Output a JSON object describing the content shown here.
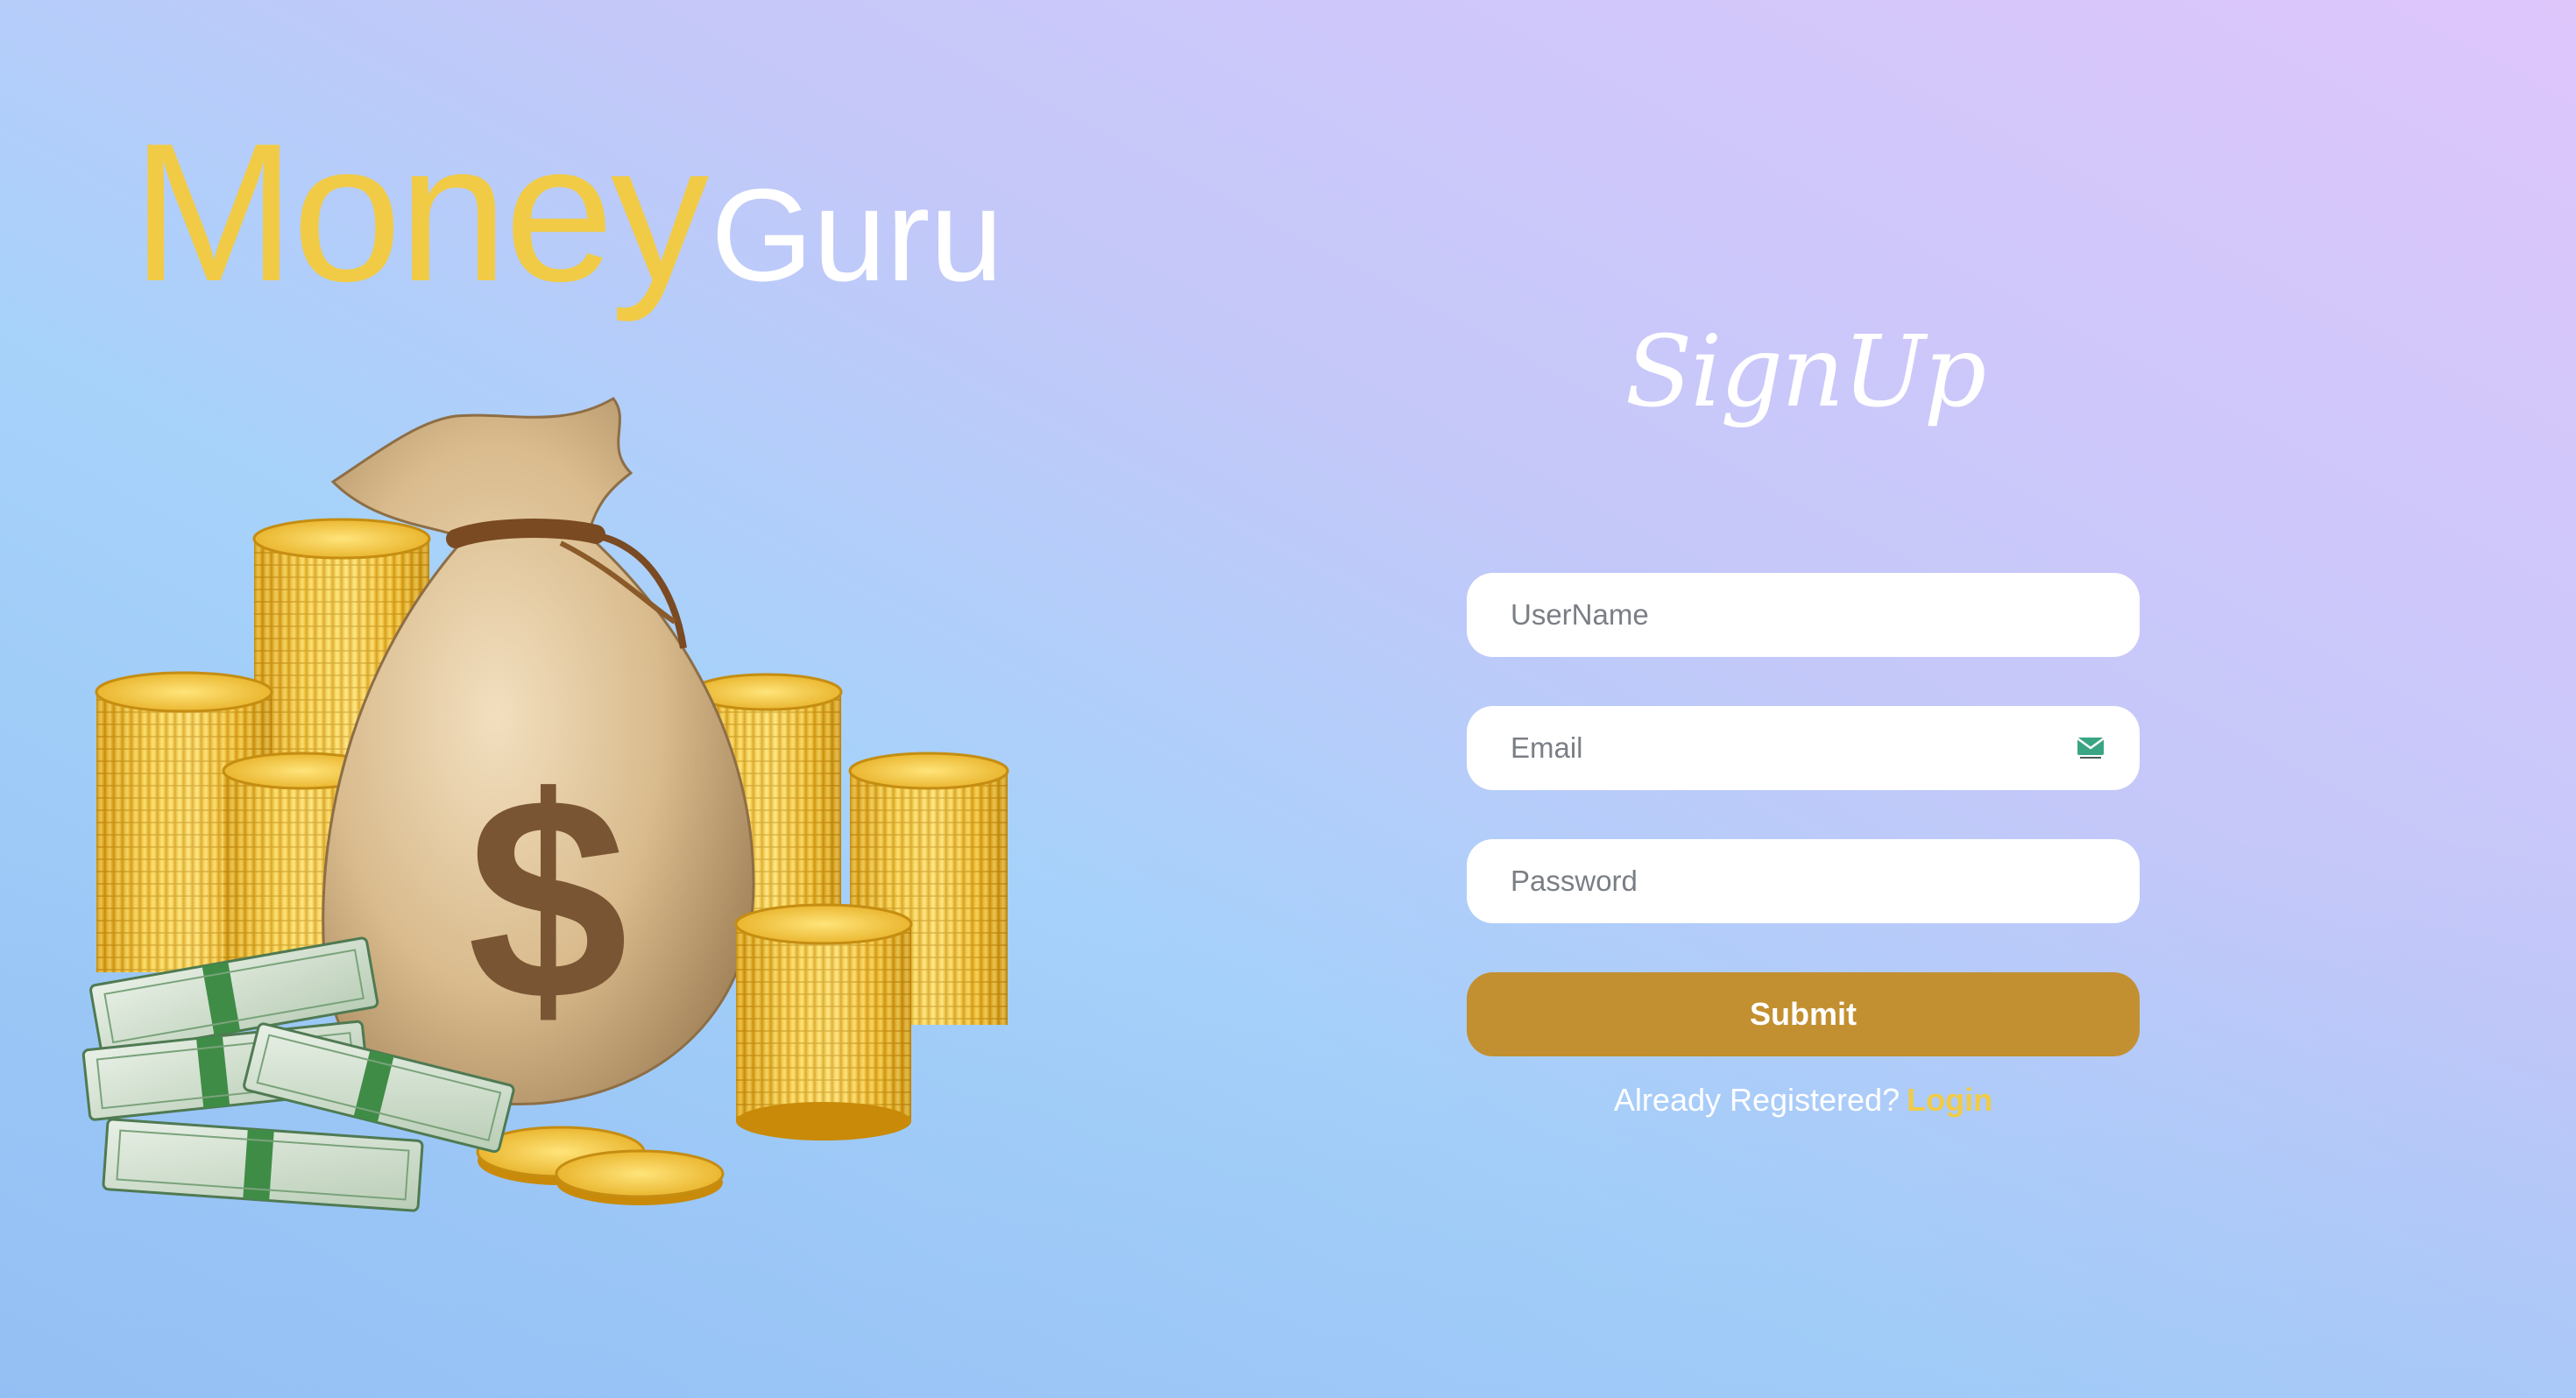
{
  "brand": {
    "part1": "Money",
    "part2": "Guru",
    "accent_color": "#f1cb45"
  },
  "illustration": {
    "name": "money-bag-with-coins-and-cash",
    "symbol": "$"
  },
  "form": {
    "title": "SignUp",
    "username_placeholder": "UserName",
    "email_placeholder": "Email",
    "password_placeholder": "Password",
    "email_icon": "mail-icon",
    "submit_label": "Submit",
    "submit_color": "#c29030",
    "already_text": "Already Registered?",
    "login_label": "Login"
  }
}
